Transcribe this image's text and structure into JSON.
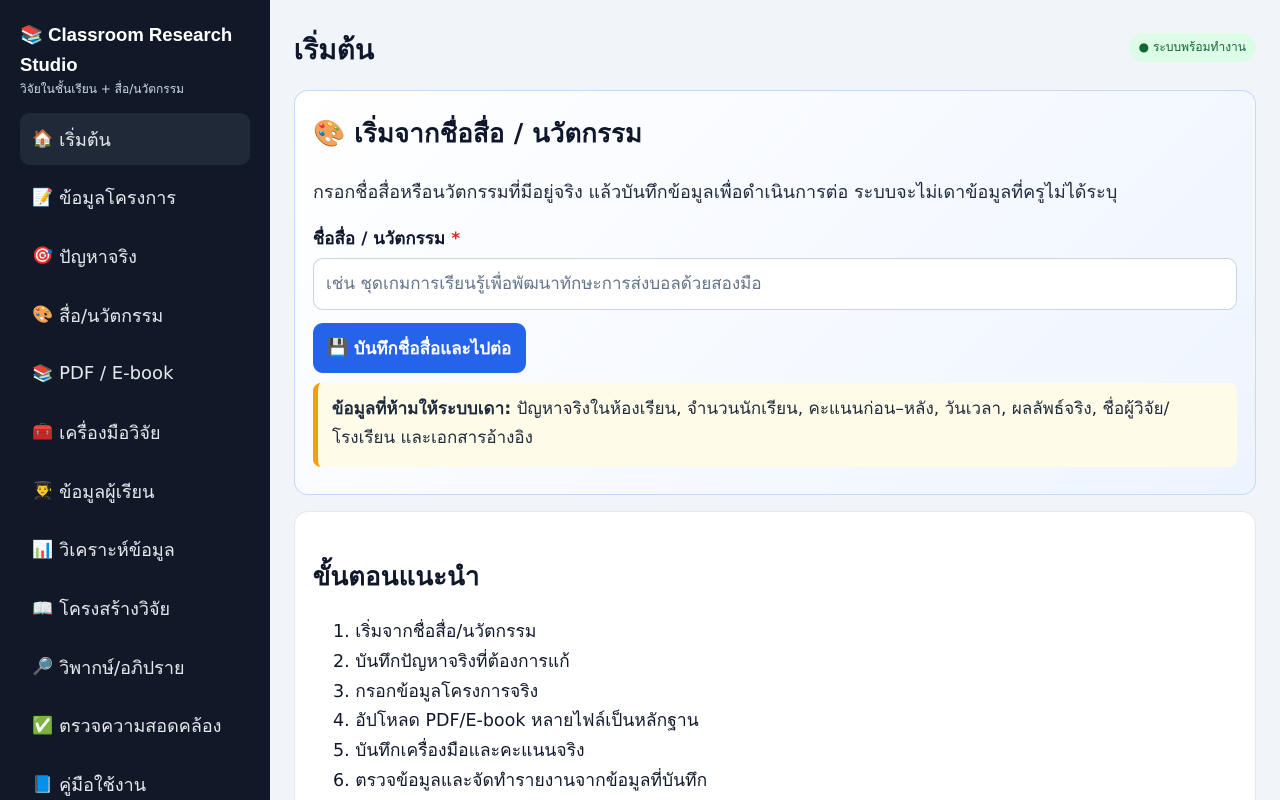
{
  "sidebar": {
    "brand_title": "📚 Classroom Research Studio",
    "brand_subtitle": "วิจัยในชั้นเรียน + สื่อ/นวัตกรรม",
    "items": [
      {
        "icon": "🏠",
        "label": "เริ่มต้น"
      },
      {
        "icon": "📝",
        "label": "ข้อมูลโครงการ"
      },
      {
        "icon": "🎯",
        "label": "ปัญหาจริง"
      },
      {
        "icon": "🎨",
        "label": "สื่อ/นวัตกรรม"
      },
      {
        "icon": "📚",
        "label": "PDF / E-book"
      },
      {
        "icon": "🧰",
        "label": "เครื่องมือวิจัย"
      },
      {
        "icon": "👨‍🎓",
        "label": "ข้อมูลผู้เรียน"
      },
      {
        "icon": "📊",
        "label": "วิเคราะห์ข้อมูล"
      },
      {
        "icon": "📖",
        "label": "โครงสร้างวิจัย"
      },
      {
        "icon": "🔎",
        "label": "วิพากษ์/อภิปราย"
      },
      {
        "icon": "✅",
        "label": "ตรวจความสอดคล้อง"
      },
      {
        "icon": "📘",
        "label": "คู่มือใช้งาน"
      }
    ]
  },
  "header": {
    "title": "เริ่มต้น",
    "status": "● ระบบพร้อมทำงาน"
  },
  "start_card": {
    "title": "🎨 เริ่มจากชื่อสื่อ / นวัตกรรม",
    "description": "กรอกชื่อสื่อหรือนวัตกรรมที่มีอยู่จริง แล้วบันทึกข้อมูลเพื่อดำเนินการต่อ ระบบจะไม่เดาข้อมูลที่ครูไม่ได้ระบุ",
    "field_label": "ชื่อสื่อ / นวัตกรรม",
    "required_mark": "*",
    "input_value": "",
    "input_placeholder": "เช่น ชุดเกมการเรียนรู้เพื่อพัฒนาทักษะการส่งบอลด้วยสองมือ",
    "save_icon": "💾",
    "save_label": "บันทึกชื่อสื่อและไปต่อ",
    "warning_bold": "ข้อมูลที่ห้ามให้ระบบเดา:",
    "warning_text": " ปัญหาจริงในห้องเรียน, จำนวนนักเรียน, คะแนนก่อน–หลัง, วันเวลา, ผลลัพธ์จริง, ชื่อผู้วิจัย/โรงเรียน และเอกสารอ้างอิง"
  },
  "steps_card": {
    "title": "ขั้นตอนแนะนำ",
    "steps": [
      "1. เริ่มจากชื่อสื่อ/นวัตกรรม",
      "2. บันทึกปัญหาจริงที่ต้องการแก้",
      "3. กรอกข้อมูลโครงการจริง",
      "4. อัปโหลด PDF/E-book หลายไฟล์เป็นหลักฐาน",
      "5. บันทึกเครื่องมือและคะแนนจริง",
      "6. ตรวจข้อมูลและจัดทำรายงานจากข้อมูลที่บันทึก"
    ]
  },
  "colors": {
    "sidebar_bg": "#111827",
    "accent": "#2563eb",
    "status_bg": "#dcfce7",
    "warning_border": "#f59e0b"
  }
}
